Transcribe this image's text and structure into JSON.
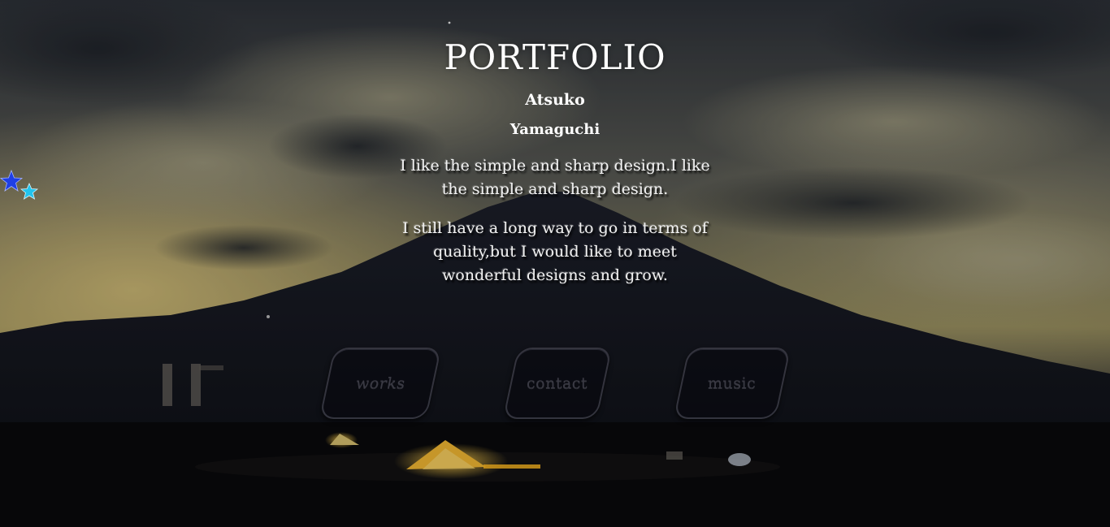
{
  "hero": {
    "title": "PORTFOLIO",
    "name_first": "Atsuko",
    "name_last": "Yamaguchi",
    "bio": [
      "I like the simple and sharp design.I like the simple and sharp design.",
      "I still have a long way to go in terms of quality,but I would like to meet wonderful designs and grow."
    ]
  },
  "nav": {
    "items": [
      {
        "label": "works"
      },
      {
        "label": "contact"
      },
      {
        "label": "music"
      }
    ]
  },
  "decor": {
    "star_icons": [
      "star-icon-blue",
      "star-icon-cyan"
    ],
    "colors": {
      "star_blue": "#1f3fe6",
      "star_cyan": "#22c4ee",
      "tent_light": "#f2b733",
      "sky_glow": "#c9b26a"
    }
  }
}
